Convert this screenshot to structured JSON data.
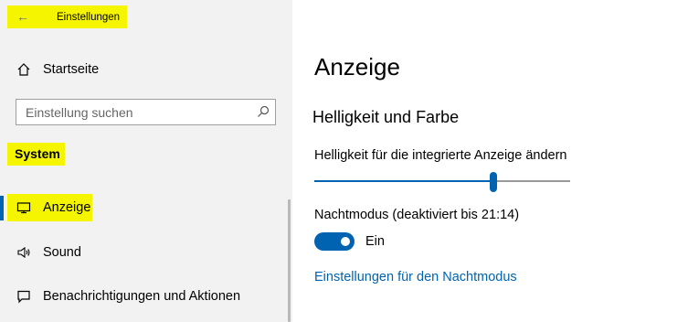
{
  "window": {
    "title": "Einstellungen"
  },
  "sidebar": {
    "home_label": "Startseite",
    "search": {
      "placeholder": "Einstellung suchen"
    },
    "section_label": "System",
    "items": [
      {
        "label": "Anzeige",
        "icon": "monitor-icon",
        "active": true
      },
      {
        "label": "Sound",
        "icon": "speaker-icon",
        "active": false
      },
      {
        "label": "Benachrichtigungen und Aktionen",
        "icon": "notification-icon",
        "active": false
      }
    ]
  },
  "main": {
    "title": "Anzeige",
    "section_title": "Helligkeit und Farbe",
    "brightness": {
      "label": "Helligkeit für die integrierte Anzeige ändern",
      "value_fraction": 0.7
    },
    "night_mode": {
      "label": "Nachtmodus (deaktiviert bis 21:14)",
      "state_label": "Ein",
      "on": true
    },
    "night_mode_link": "Einstellungen für den Nachtmodus"
  },
  "colors": {
    "accent": "#0063b1",
    "highlight": "#f5f500",
    "sidebar_bg": "#f2f2f2"
  }
}
